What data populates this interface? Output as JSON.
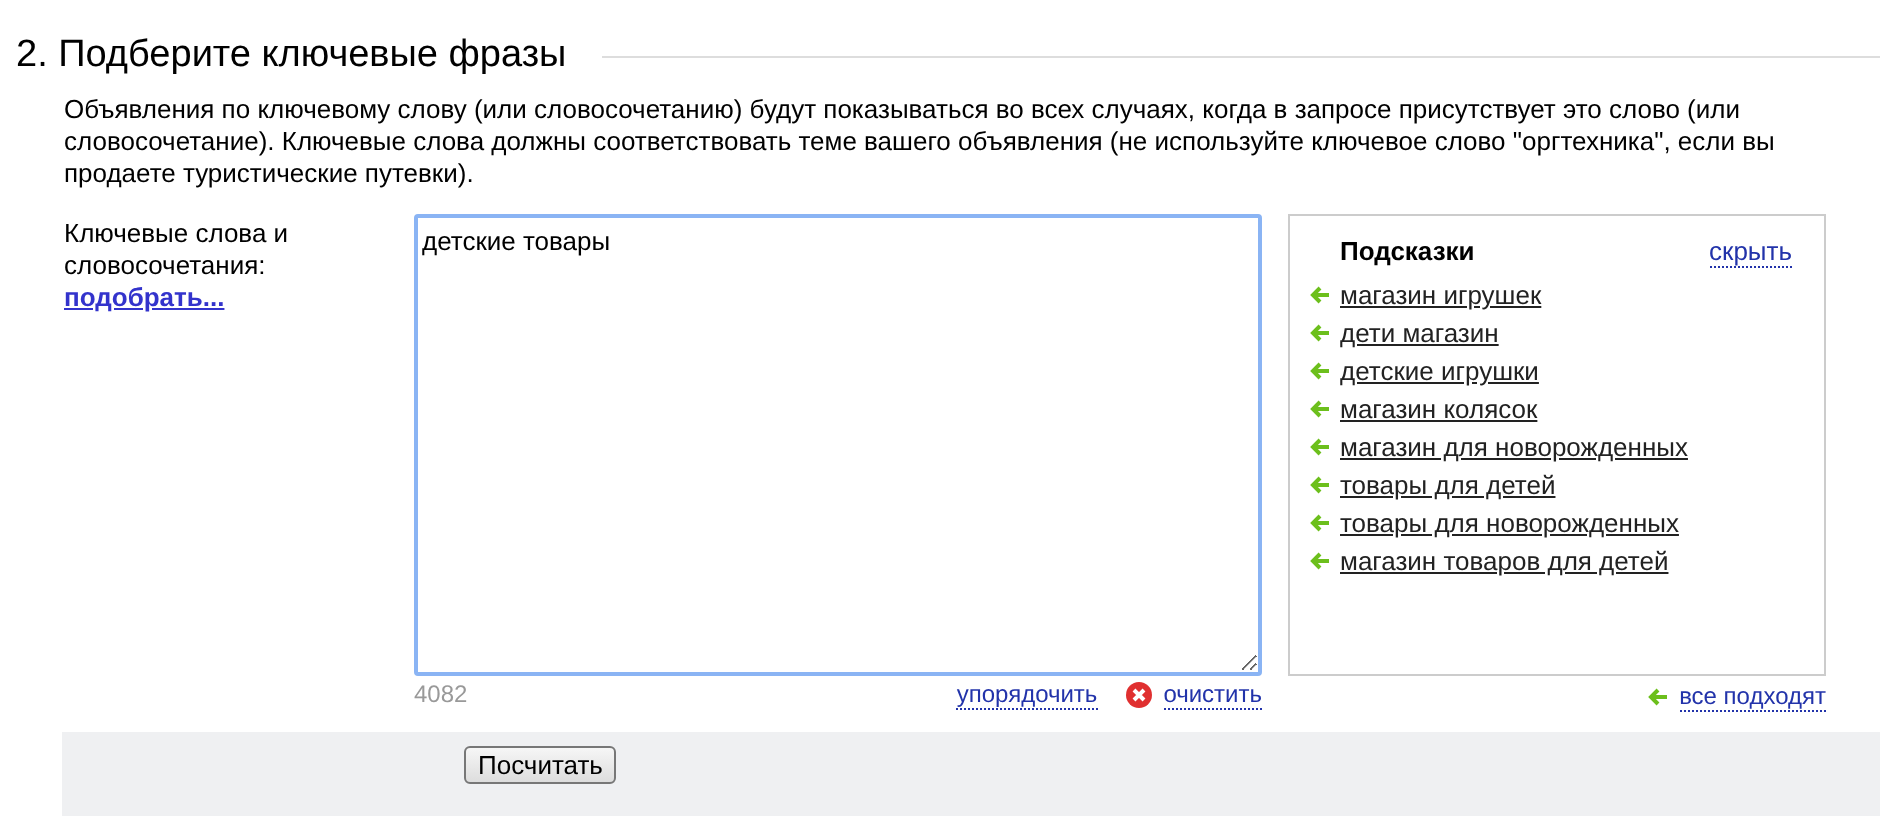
{
  "heading": "2. Подберите ключевые фразы",
  "description": "Объявления по ключевому слову (или словосочетанию) будут показываться во всех случаях, когда в запросе присутствует это слово (или словосочетание). Ключевые слова должны соответствовать теме вашего объявления (не используйте ключевое слово \"оргтехника\", если вы продаете туристические путевки).",
  "field_label": "Ключевые слова и словосочетания:",
  "pick_link": "подобрать...",
  "keywords": {
    "value": "детские товары"
  },
  "counter": "4082",
  "sort_link": "упорядочить",
  "clear_link": "очистить",
  "hints": {
    "title": "Подсказки",
    "hide_link": "скрыть",
    "items": [
      {
        "text": "магазин игрушек"
      },
      {
        "text": "дети магазин"
      },
      {
        "text": "детские игрушки"
      },
      {
        "text": "магазин колясок"
      },
      {
        "text": "магазин для новорожденных"
      },
      {
        "text": "товары для детей"
      },
      {
        "text": "товары для новорожденных"
      },
      {
        "text": "магазин товаров для детей"
      }
    ],
    "all_link": "все подходят"
  },
  "button": "Посчитать"
}
